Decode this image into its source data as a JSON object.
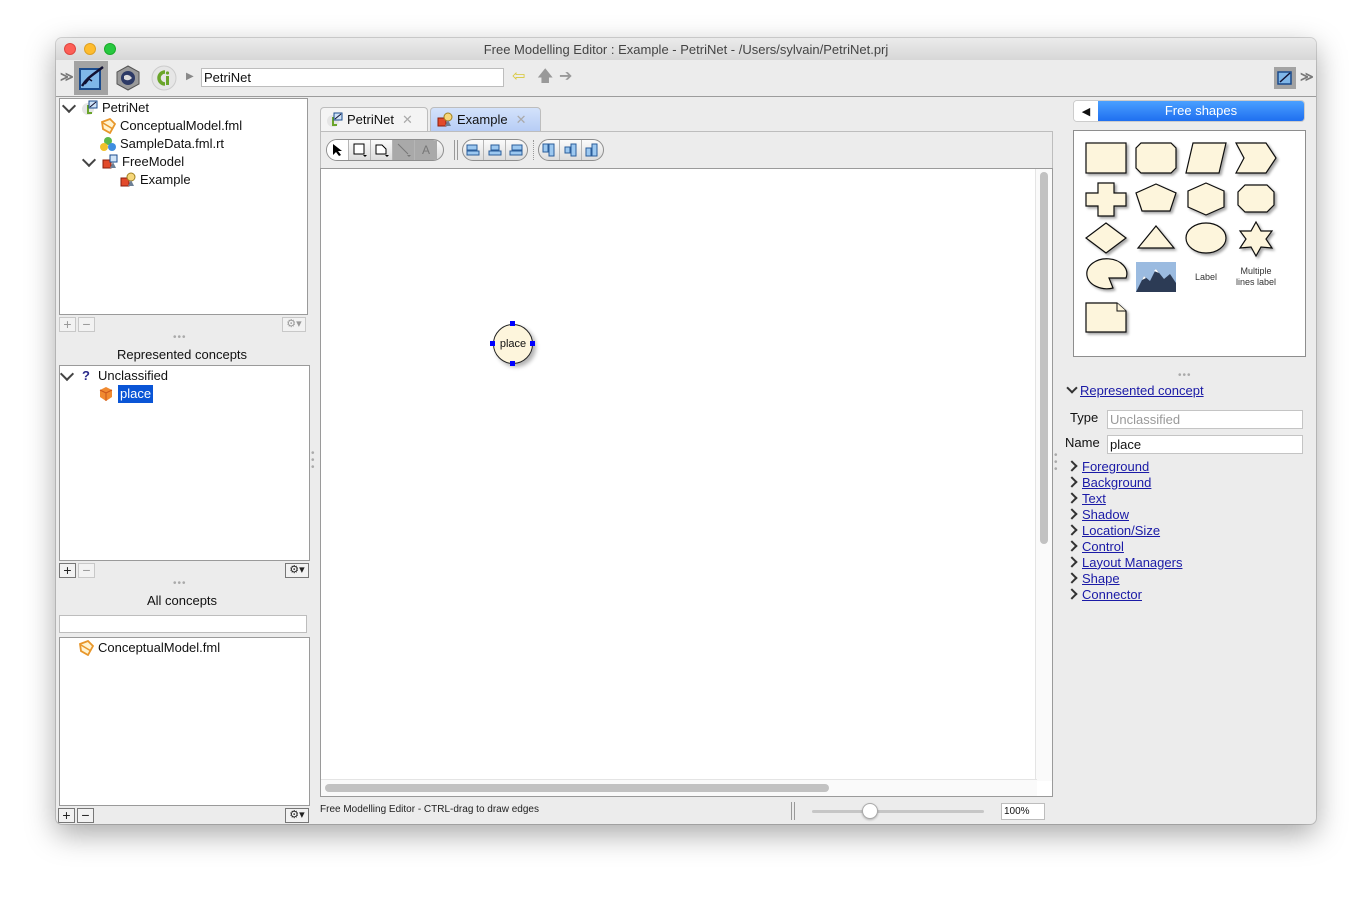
{
  "window": {
    "title": "Free Modelling Editor : Example - PetriNet - /Users/sylvain/PetriNet.prj"
  },
  "toolbar": {
    "perspectives": [
      "free-modelling-perspective",
      "technology-perspective",
      "cg-perspective"
    ],
    "path_value": "PetriNet",
    "nav": {
      "back": "back-arrow",
      "up": "up-arrow",
      "forward": "forward-arrow"
    }
  },
  "project_browser": {
    "items": [
      {
        "label": "PetriNet",
        "icon": "project-icon",
        "expanded": true
      },
      {
        "label": "ConceptualModel.fml",
        "icon": "conceptual-model-icon"
      },
      {
        "label": "SampleData.fml.rt",
        "icon": "sample-data-icon"
      },
      {
        "label": "FreeModel",
        "icon": "free-model-icon",
        "expanded": true
      },
      {
        "label": "Example",
        "icon": "diagram-icon"
      }
    ]
  },
  "represented_concepts": {
    "title": "Represented concepts",
    "items": [
      {
        "label": "Unclassified",
        "icon": "question-icon",
        "expanded": true
      },
      {
        "label": "place",
        "icon": "concept-icon",
        "selected": true
      }
    ]
  },
  "all_concepts": {
    "title": "All concepts",
    "search_value": "",
    "items": [
      {
        "label": "ConceptualModel.fml",
        "icon": "conceptual-model-icon"
      }
    ]
  },
  "editor": {
    "tabs": [
      {
        "label": "PetriNet",
        "active": false
      },
      {
        "label": "Example",
        "active": true
      }
    ],
    "tools": {
      "drawing": [
        "select",
        "draw-shape",
        "draw-connector",
        "draw-line",
        "draw-text"
      ],
      "align_horizontal": [
        "align-left",
        "align-center",
        "align-right"
      ],
      "align_vertical": [
        "align-top",
        "align-middle",
        "align-bottom"
      ]
    },
    "canvas": {
      "shapes": [
        {
          "label": "place",
          "type": "circle",
          "selected": true
        }
      ]
    },
    "status_text": "Free Modelling Editor - CTRL-drag to draw edges",
    "zoom_value": "100%",
    "zoom_slider_fraction": 0.34
  },
  "palette": {
    "title": "Free shapes",
    "items": [
      "rectangle",
      "rounded-rectangle",
      "parallelogram",
      "chevron",
      "plus",
      "pentagon",
      "hexagon",
      "octagon",
      "diamond",
      "triangle",
      "ellipse",
      "star",
      "pie",
      "image",
      "Label",
      "Multiple lines label",
      "note"
    ],
    "label_text": "Label",
    "multi_label_text": "Multiple lines label"
  },
  "inspector": {
    "section_title": "Represented concept",
    "type_label": "Type",
    "type_value": "Unclassified",
    "name_label": "Name",
    "name_value": "place",
    "sections": [
      "Foreground",
      "Background",
      "Text",
      "Shadow",
      "Location/Size",
      "Control",
      "Layout Managers",
      "Shape",
      "Connector"
    ]
  }
}
